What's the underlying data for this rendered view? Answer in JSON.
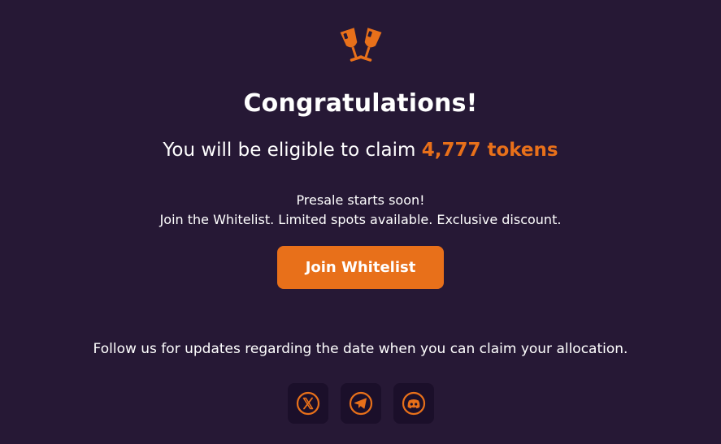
{
  "header": {
    "icon": "champagne-toast-icon",
    "title": "Congratulations!"
  },
  "claim": {
    "prefix": "You will be eligible to claim",
    "amount": "4,777 tokens"
  },
  "presale": {
    "line1": "Presale starts soon!",
    "line2": "Join the Whitelist. Limited spots available. Exclusive discount."
  },
  "cta": {
    "label": "Join Whitelist"
  },
  "follow": {
    "text": "Follow us for updates regarding the date when you can claim your allocation."
  },
  "socials": [
    {
      "name": "x-icon"
    },
    {
      "name": "telegram-icon"
    },
    {
      "name": "discord-icon"
    }
  ],
  "colors": {
    "background": "#261835",
    "accent": "#e8701a",
    "text": "#ffffff",
    "social_bg": "#1b0f2a"
  }
}
